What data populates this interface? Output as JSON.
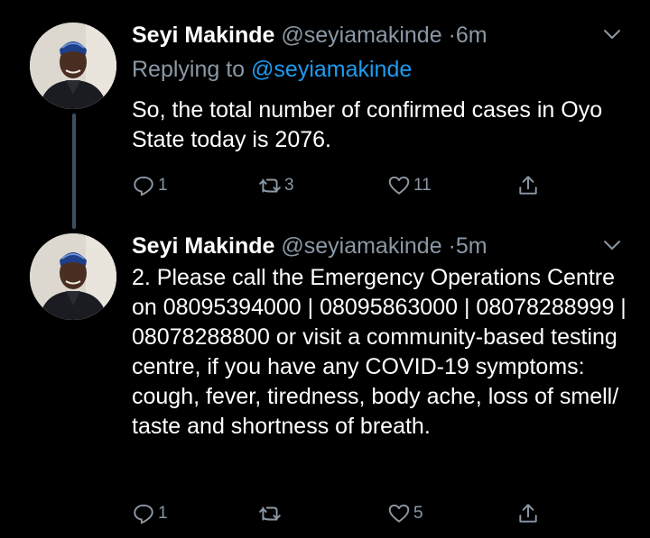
{
  "tweets": [
    {
      "author": {
        "display_name": "Seyi Makinde",
        "handle": "@seyiamakinde",
        "avatar_icon": "profile-photo"
      },
      "separator": "·",
      "time": "6m",
      "replying_prefix": "Replying to",
      "replying_to": "@seyiamakinde",
      "text": "So, the total number of confirmed cases in Oyo State today is 2076.",
      "reply_count": "1",
      "retweet_count": "3",
      "like_count": "11"
    },
    {
      "author": {
        "display_name": "Seyi Makinde",
        "handle": "@seyiamakinde",
        "avatar_icon": "profile-photo"
      },
      "separator": "·",
      "time": "5m",
      "text": "2. Please call the Emergency Operations Centre on 08095394000 | 08095863000 | 08078288999 | 08078288800 or visit a community-based testing centre, if you have any COVID-19 symptoms: cough, fever, tiredness, body ache, loss of smell/ taste and shortness of breath.",
      "reply_count": "1",
      "retweet_count": "",
      "like_count": "5"
    }
  ],
  "colors": {
    "background": "#000000",
    "primary_text": "#ffffff",
    "secondary_text": "#8b98a5",
    "accent": "#1d9bf0",
    "thread_line": "#3d4f5f"
  }
}
